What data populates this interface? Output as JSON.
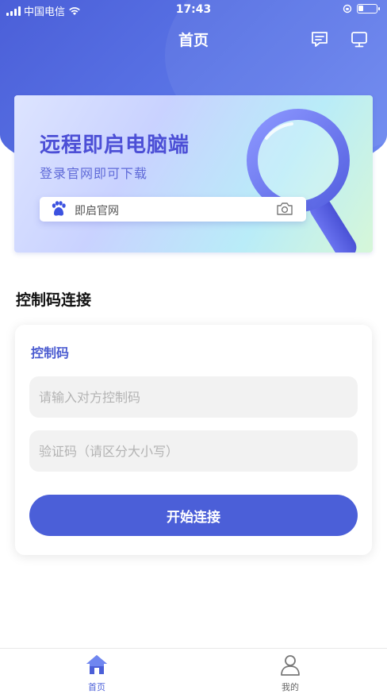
{
  "status_bar": {
    "carrier": "中国电信",
    "time": "17:43"
  },
  "header": {
    "title": "首页",
    "icons": [
      "message-icon",
      "monitor-icon"
    ]
  },
  "banner": {
    "title": "远程即启电脑端",
    "subtitle": "登录官网即可下载",
    "search_text": "即启官网",
    "search_icons": [
      "baidu-paw-icon",
      "camera-icon"
    ]
  },
  "section": {
    "title": "控制码连接"
  },
  "form": {
    "label": "控制码",
    "code_input": {
      "placeholder": "请输入对方控制码",
      "value": ""
    },
    "verify_input": {
      "placeholder": "验证码（请区分大小写）",
      "value": ""
    },
    "connect_label": "开始连接"
  },
  "tabbar": {
    "items": [
      {
        "label": "首页",
        "icon": "home-icon",
        "active": true
      },
      {
        "label": "我的",
        "icon": "user-icon",
        "active": false
      }
    ]
  },
  "colors": {
    "primary": "#4b5fd8",
    "banner_title": "#4c4fd6",
    "tab_active": "#4b5fd8",
    "tab_inactive": "#666666"
  }
}
